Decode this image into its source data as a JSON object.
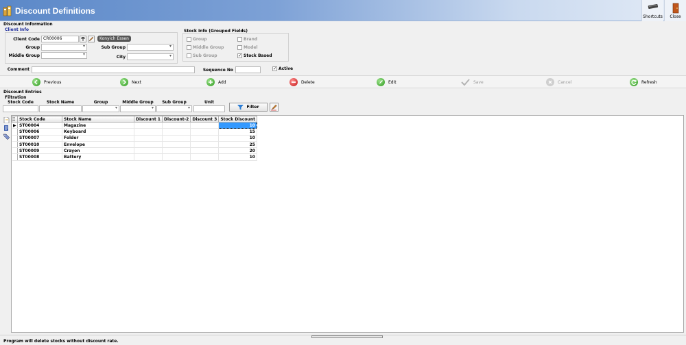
{
  "window": {
    "title": "Discount Definitions",
    "shortcuts_label": "Shortcuts",
    "close_label": "Close"
  },
  "discount_info": {
    "section_label": "Discount Information",
    "client_info_label": "Client Info",
    "client_code_label": "Client Code",
    "client_code_value": "CR00006",
    "client_name_tag": "Konyich Essen",
    "group_label": "Group",
    "middle_group_label": "Middle Group",
    "sub_group_label": "Sub Group",
    "city_label": "City",
    "comment_label": "Comment",
    "sequence_no_label": "Sequence No",
    "active_label": "Active",
    "active_checked": true
  },
  "stock_info": {
    "title": "Stock Info (Grouped Fields)",
    "group": "Group",
    "middle_group": "Middle Group",
    "sub_group": "Sub Group",
    "brand": "Brand",
    "model": "Model",
    "stock_based": "Stock Based",
    "stock_based_checked": true
  },
  "nav": {
    "previous": "Previous",
    "next": "Next",
    "add": "Add",
    "delete": "Delete",
    "edit": "Edit",
    "save": "Save",
    "cancel": "Cancel",
    "refresh": "Refresh"
  },
  "entries": {
    "section_label": "Discount Entries",
    "filtration_label": "Filtration",
    "filters": {
      "stock_code": "Stock Code",
      "stock_name": "Stock Name",
      "group": "Group",
      "middle_group": "Middle Group",
      "sub_group": "Sub Group",
      "unit": "Unit"
    },
    "filter_button": "Filter"
  },
  "grid": {
    "columns": [
      "Stock Code",
      "Stock Name",
      "Discount 1",
      "Discount-2",
      "Discount 3",
      "Stock Discount"
    ],
    "rows": [
      {
        "code": "ST00004",
        "name": "Magazine",
        "d1": "",
        "d2": "",
        "d3": "",
        "stock_discount": "10"
      },
      {
        "code": "ST00006",
        "name": "Keyboard",
        "d1": "",
        "d2": "",
        "d3": "",
        "stock_discount": "15"
      },
      {
        "code": "ST00007",
        "name": "Folder",
        "d1": "",
        "d2": "",
        "d3": "",
        "stock_discount": "10"
      },
      {
        "code": "ST00010",
        "name": "Envelope",
        "d1": "",
        "d2": "",
        "d3": "",
        "stock_discount": "25"
      },
      {
        "code": "ST00009",
        "name": "Crayon",
        "d1": "",
        "d2": "",
        "d3": "",
        "stock_discount": "20"
      },
      {
        "code": "ST00008",
        "name": "Battery",
        "d1": "",
        "d2": "",
        "d3": "",
        "stock_discount": "10"
      }
    ]
  },
  "status": {
    "message": "Program will delete stocks without discount rate."
  },
  "colors": {
    "title_gradient_start": "#5b88c8",
    "selection": "#3399ff",
    "section_blue": "#1a2a9a"
  }
}
